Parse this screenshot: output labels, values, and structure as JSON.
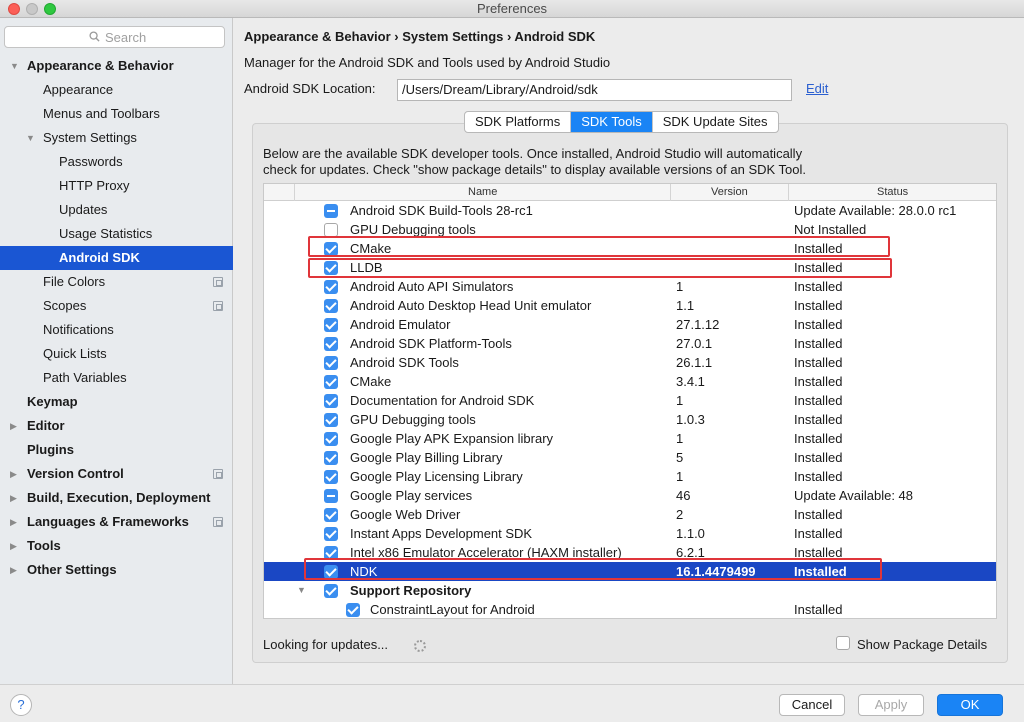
{
  "window": {
    "title": "Preferences"
  },
  "sidebar": {
    "search_placeholder": "Search",
    "items": [
      {
        "label": "Appearance & Behavior"
      },
      {
        "label": "Appearance"
      },
      {
        "label": "Menus and Toolbars"
      },
      {
        "label": "System Settings"
      },
      {
        "label": "Passwords"
      },
      {
        "label": "HTTP Proxy"
      },
      {
        "label": "Updates"
      },
      {
        "label": "Usage Statistics"
      },
      {
        "label": "Android SDK"
      },
      {
        "label": "File Colors"
      },
      {
        "label": "Scopes"
      },
      {
        "label": "Notifications"
      },
      {
        "label": "Quick Lists"
      },
      {
        "label": "Path Variables"
      },
      {
        "label": "Keymap"
      },
      {
        "label": "Editor"
      },
      {
        "label": "Plugins"
      },
      {
        "label": "Version Control"
      },
      {
        "label": "Build, Execution, Deployment"
      },
      {
        "label": "Languages & Frameworks"
      },
      {
        "label": "Tools"
      },
      {
        "label": "Other Settings"
      }
    ]
  },
  "main": {
    "breadcrumb": "Appearance & Behavior  ›  System Settings  ›  Android SDK",
    "description": "Manager for the Android SDK and Tools used by Android Studio",
    "location_label": "Android SDK Location:",
    "location_value": "/Users/Dream/Library/Android/sdk",
    "edit_label": "Edit",
    "tabs": [
      {
        "label": "SDK Platforms"
      },
      {
        "label": "SDK Tools"
      },
      {
        "label": "SDK Update Sites"
      }
    ],
    "intro_line1": "Below are the available SDK developer tools. Once installed, Android Studio will automatically",
    "intro_line2": "check for updates. Check \"show package details\" to display available versions of an SDK Tool.",
    "columns": {
      "name": "Name",
      "version": "Version",
      "status": "Status"
    },
    "rows": [
      {
        "name": "Android SDK Build-Tools 28-rc1",
        "version": "",
        "status": "Update Available: 28.0.0 rc1"
      },
      {
        "name": "GPU Debugging tools",
        "version": "",
        "status": "Not Installed"
      },
      {
        "name": "CMake",
        "version": "",
        "status": "Installed"
      },
      {
        "name": "LLDB",
        "version": "",
        "status": "Installed"
      },
      {
        "name": "Android Auto API Simulators",
        "version": "1",
        "status": "Installed"
      },
      {
        "name": "Android Auto Desktop Head Unit emulator",
        "version": "1.1",
        "status": "Installed"
      },
      {
        "name": "Android Emulator",
        "version": "27.1.12",
        "status": "Installed"
      },
      {
        "name": "Android SDK Platform-Tools",
        "version": "27.0.1",
        "status": "Installed"
      },
      {
        "name": "Android SDK Tools",
        "version": "26.1.1",
        "status": "Installed"
      },
      {
        "name": "CMake",
        "version": "3.4.1",
        "status": "Installed"
      },
      {
        "name": "Documentation for Android SDK",
        "version": "1",
        "status": "Installed"
      },
      {
        "name": "GPU Debugging tools",
        "version": "1.0.3",
        "status": "Installed"
      },
      {
        "name": "Google Play APK Expansion library",
        "version": "1",
        "status": "Installed"
      },
      {
        "name": "Google Play Billing Library",
        "version": "5",
        "status": "Installed"
      },
      {
        "name": "Google Play Licensing Library",
        "version": "1",
        "status": "Installed"
      },
      {
        "name": "Google Play services",
        "version": "46",
        "status": "Update Available: 48"
      },
      {
        "name": "Google Web Driver",
        "version": "2",
        "status": "Installed"
      },
      {
        "name": "Instant Apps Development SDK",
        "version": "1.1.0",
        "status": "Installed"
      },
      {
        "name": "Intel x86 Emulator Accelerator (HAXM installer)",
        "version": "6.2.1",
        "status": "Installed"
      },
      {
        "name": "NDK",
        "version": "16.1.4479499",
        "status": "Installed"
      },
      {
        "name": "Support Repository",
        "version": "",
        "status": ""
      },
      {
        "name": "ConstraintLayout for Android",
        "version": "",
        "status": "Installed"
      }
    ],
    "looking_label": "Looking for updates...",
    "show_details_label": "Show Package Details"
  },
  "footer": {
    "help": "?",
    "cancel": "Cancel",
    "apply": "Apply",
    "ok": "OK"
  },
  "colors": {
    "selection": "#1a56d3",
    "accent": "#1a84f5",
    "highlight_box": "#e0353a"
  }
}
